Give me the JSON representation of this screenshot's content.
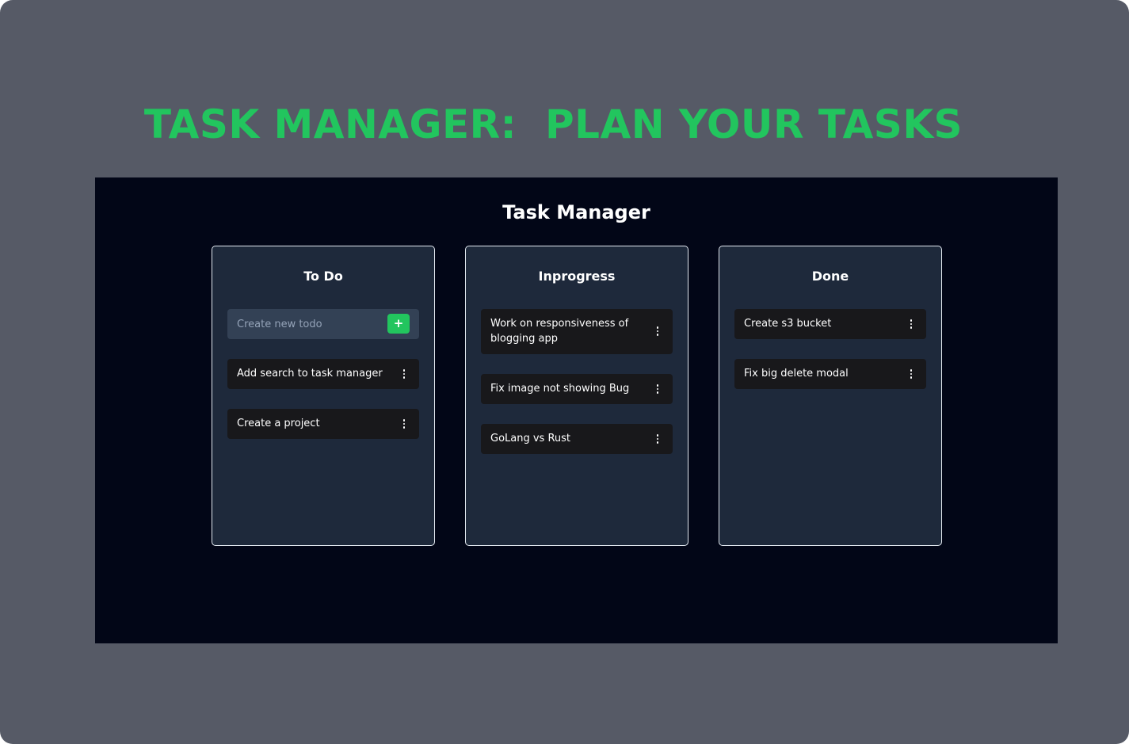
{
  "headline": "TASK MANAGER:  PLAN YOUR TASKS",
  "app": {
    "title": "Task Manager",
    "columns": [
      {
        "title": "To Do",
        "create_placeholder": "Create new todo",
        "add_label": "+",
        "tasks": [
          "Add search to task manager",
          "Create a project"
        ]
      },
      {
        "title": "Inprogress",
        "tasks": [
          "Work on responsiveness of blogging app",
          "Fix image not showing Bug",
          "GoLang vs Rust"
        ]
      },
      {
        "title": "Done",
        "tasks": [
          "Create s3 bucket",
          "Fix big delete modal"
        ]
      }
    ]
  },
  "colors": {
    "accent": "#22c55e",
    "outer_background": "#565a66",
    "app_background": "#020617",
    "column_background": "#1e293b",
    "task_background": "#18181b"
  }
}
